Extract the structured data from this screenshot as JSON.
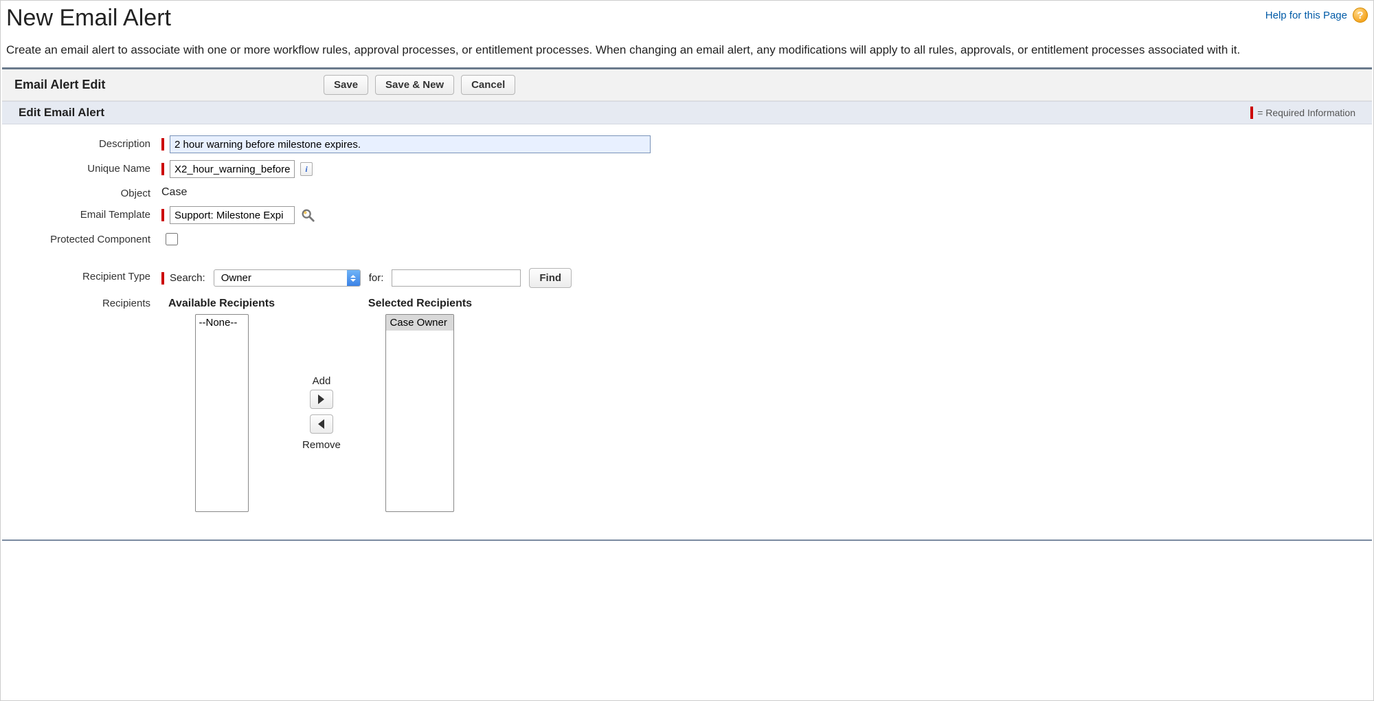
{
  "header": {
    "title": "New Email Alert",
    "help_text": "Help for this Page"
  },
  "intro": "Create an email alert to associate with one or more workflow rules, approval processes, or entitlement processes. When changing an email alert, any modifications will apply to all rules, approvals, or entitlement processes associated with it.",
  "panel": {
    "title": "Email Alert Edit",
    "buttons": {
      "save": "Save",
      "save_new": "Save & New",
      "cancel": "Cancel"
    }
  },
  "section": {
    "title": "Edit Email Alert",
    "required_text": "= Required Information"
  },
  "fields": {
    "description": {
      "label": "Description",
      "value": "2 hour warning before milestone expires."
    },
    "unique_name": {
      "label": "Unique Name",
      "value": "X2_hour_warning_before"
    },
    "object": {
      "label": "Object",
      "value": "Case"
    },
    "email_template": {
      "label": "Email Template",
      "value": "Support: Milestone Expi"
    },
    "protected": {
      "label": "Protected Component",
      "checked": false
    },
    "recipient_type": {
      "label": "Recipient Type",
      "search_label": "Search:",
      "search_select": "Owner",
      "for_label": "for:",
      "find_button": "Find"
    },
    "recipients": {
      "label": "Recipients",
      "available_label": "Available Recipients",
      "selected_label": "Selected Recipients",
      "available": [
        "--None--"
      ],
      "selected": [
        "Case Owner"
      ],
      "add_label": "Add",
      "remove_label": "Remove"
    }
  }
}
